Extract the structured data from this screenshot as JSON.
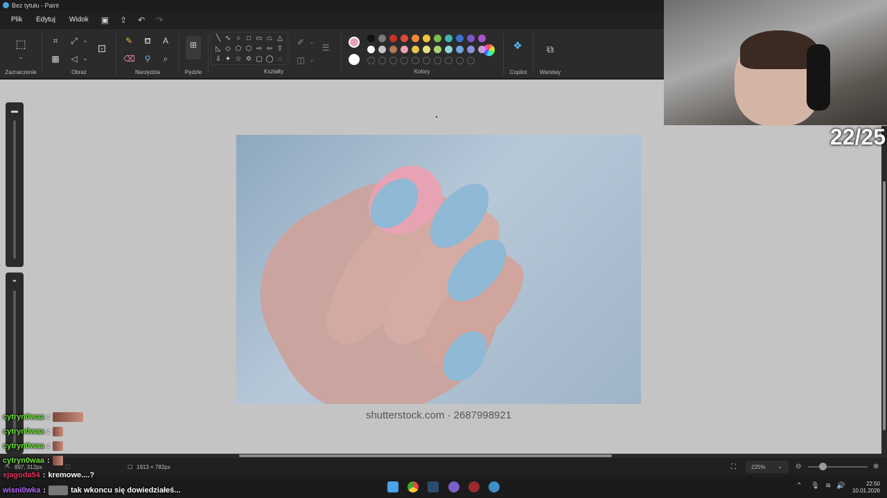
{
  "window": {
    "title": "Bez tytułu - Paint"
  },
  "menu": {
    "file": "Plik",
    "edit": "Edytuj",
    "view": "Widok"
  },
  "ribbon": {
    "groups": {
      "selection": "Zaznaczenie",
      "image": "Obraz",
      "tools": "Narzędzia",
      "brushes": "Pędzle",
      "shapes": "Kształty",
      "colors": "Kolory",
      "copilot": "Copilot",
      "layers": "Warstwy"
    },
    "shape_glyphs": [
      "╲",
      "∿",
      "○",
      "□",
      "▭",
      "⏢",
      "△",
      "◺",
      "◇",
      "⬠",
      "⬡",
      "⇨",
      "⇦",
      "⇧",
      "⇩",
      "✦",
      "☆",
      "✡",
      "▢",
      "◯",
      "◌"
    ],
    "current_color": "#e7a3b4",
    "secondary_color": "#ffffff",
    "palette_row1": [
      "#111111",
      "#7a7a7a",
      "#c8322d",
      "#e04a3b",
      "#f08b37",
      "#f0c63a",
      "#7bbf4a",
      "#3fb4b5",
      "#3c6fcf",
      "#7b56c7",
      "#a855c9"
    ],
    "palette_row2": [
      "#ffffff",
      "#c4c4c4",
      "#b07a57",
      "#e9a0b2",
      "#e7c34a",
      "#e8e07a",
      "#a8d36b",
      "#8fd6d6",
      "#6fa6e0",
      "#8d93d8",
      "#c59ad8"
    ]
  },
  "canvas": {
    "caption": "shutterstock.com · 2687998921"
  },
  "status": {
    "cursor": "897, 312px",
    "size": "1913 × 782px",
    "zoom": "225%",
    "clock_time": "22:50",
    "clock_date": "10.01.2026"
  },
  "overlay": {
    "counter": "22/25",
    "chat": [
      {
        "user": "cytryn0waa",
        "sep": ":",
        "text": "",
        "color": "#6fe03a"
      },
      {
        "user": "cytryn0waa",
        "sep": ":",
        "text": "",
        "color": "#6fe03a"
      },
      {
        "user": "cytryn0waa",
        "sep": ":",
        "text": "",
        "color": "#6fe03a"
      },
      {
        "user": "cytryn0waa",
        "sep": ":",
        "text": "",
        "color": "#6fe03a"
      },
      {
        "user": "xjagoda54",
        "sep": ":",
        "text": "kremowe....?",
        "color": "#e0345c"
      },
      {
        "user": "wisni0wka",
        "sep": ":",
        "text": "tak wkoncu się dowiedziałeś...",
        "color": "#b566ff"
      }
    ]
  }
}
